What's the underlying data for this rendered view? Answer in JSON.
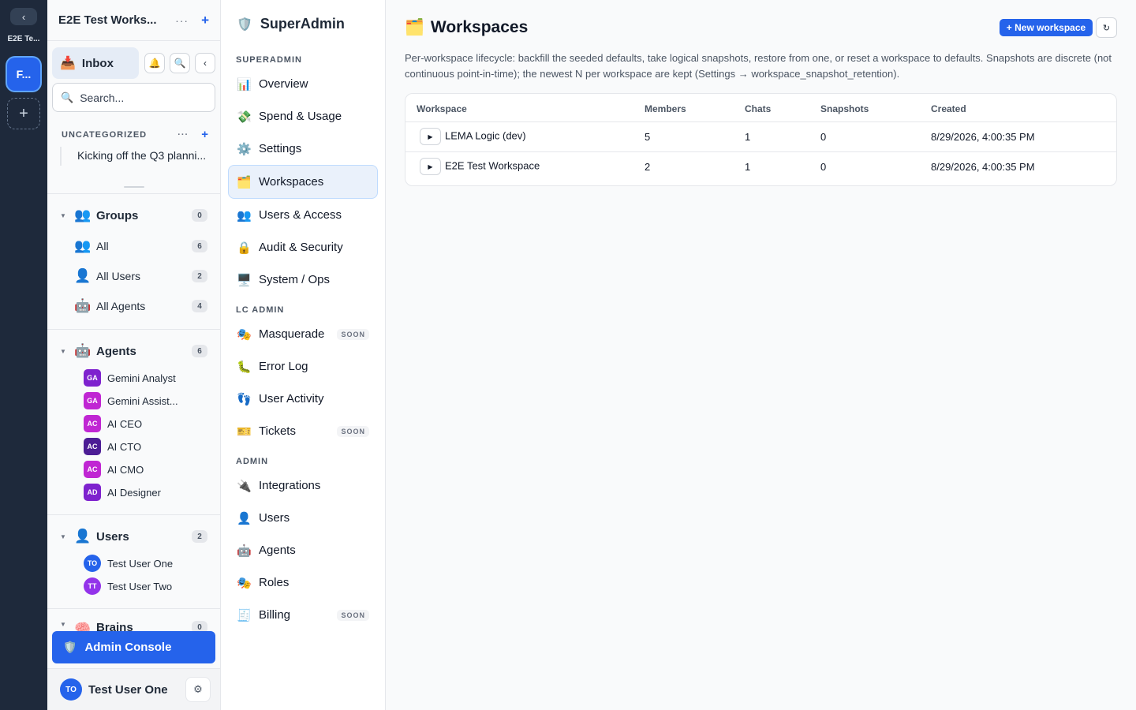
{
  "rail": {
    "collapse_glyph": "‹",
    "workspace_short": "E2E Te...",
    "workspace_tile": "F...",
    "add_glyph": "+"
  },
  "sidebar": {
    "title": "E2E Test Works...",
    "inbox_label": "Inbox",
    "search_placeholder": "Search...",
    "uncategorized_label": "UNCATEGORIZED",
    "chat_item": "Kicking off the Q3 planni...",
    "groups": {
      "label": "Groups",
      "count": "0",
      "items": [
        {
          "label": "All",
          "count": "6",
          "icon": "people-icon"
        },
        {
          "label": "All Users",
          "count": "2",
          "icon": "user-icon"
        },
        {
          "label": "All Agents",
          "count": "4",
          "icon": "robot-icon"
        }
      ]
    },
    "agents": {
      "label": "Agents",
      "count": "6",
      "items": [
        {
          "initials": "GA",
          "label": "Gemini Analyst",
          "color": "#7e22ce"
        },
        {
          "initials": "GA",
          "label": "Gemini Assist...",
          "color": "#c026d3"
        },
        {
          "initials": "AC",
          "label": "AI CEO",
          "color": "#c026d3"
        },
        {
          "initials": "AC",
          "label": "AI CTO",
          "color": "#4c1d95"
        },
        {
          "initials": "AC",
          "label": "AI CMO",
          "color": "#c026d3"
        },
        {
          "initials": "AD",
          "label": "AI Designer",
          "color": "#7e22ce"
        }
      ]
    },
    "users": {
      "label": "Users",
      "count": "2",
      "items": [
        {
          "initials": "TO",
          "label": "Test User One",
          "color": "#2563eb"
        },
        {
          "initials": "TT",
          "label": "Test User Two",
          "color": "#9333ea"
        }
      ]
    },
    "brains": {
      "label": "Brains",
      "count": "0"
    },
    "admin_console_label": "Admin Console",
    "current_user": {
      "initials": "TO",
      "name": "Test User One"
    }
  },
  "adminnav": {
    "brand": "SuperAdmin",
    "sections": {
      "superadmin": "SUPERADMIN",
      "lc_admin": "LC ADMIN",
      "admin": "ADMIN"
    },
    "items": {
      "overview": "Overview",
      "spend": "Spend & Usage",
      "settings": "Settings",
      "workspaces": "Workspaces",
      "users_access": "Users & Access",
      "audit": "Audit & Security",
      "system": "System / Ops",
      "masquerade": "Masquerade",
      "error_log": "Error Log",
      "user_activity": "User Activity",
      "tickets": "Tickets",
      "integrations": "Integrations",
      "users": "Users",
      "agents": "Agents",
      "roles": "Roles",
      "billing": "Billing"
    },
    "soon_label": "SOON"
  },
  "main": {
    "title": "Workspaces",
    "new_button": "+ New workspace",
    "refresh_glyph": "↻",
    "description": "Per-workspace lifecycle: backfill the seeded defaults, take logical snapshots, restore from one, or reset a workspace to defaults. Snapshots are discrete (not continuous point-in-time); the newest N per workspace are kept (Settings → workspace_snapshot_retention).",
    "table": {
      "headers": [
        "Workspace",
        "Members",
        "Chats",
        "Snapshots",
        "Created"
      ],
      "rows": [
        [
          "LEMA Logic (dev)",
          "5",
          "1",
          "0",
          "8/29/2026, 4:00:35 PM"
        ],
        [
          "E2E Test Workspace",
          "2",
          "1",
          "0",
          "8/29/2026, 4:00:35 PM"
        ]
      ]
    }
  },
  "colors": {
    "accent": "#2563eb",
    "rail_bg": "#1e293b"
  }
}
